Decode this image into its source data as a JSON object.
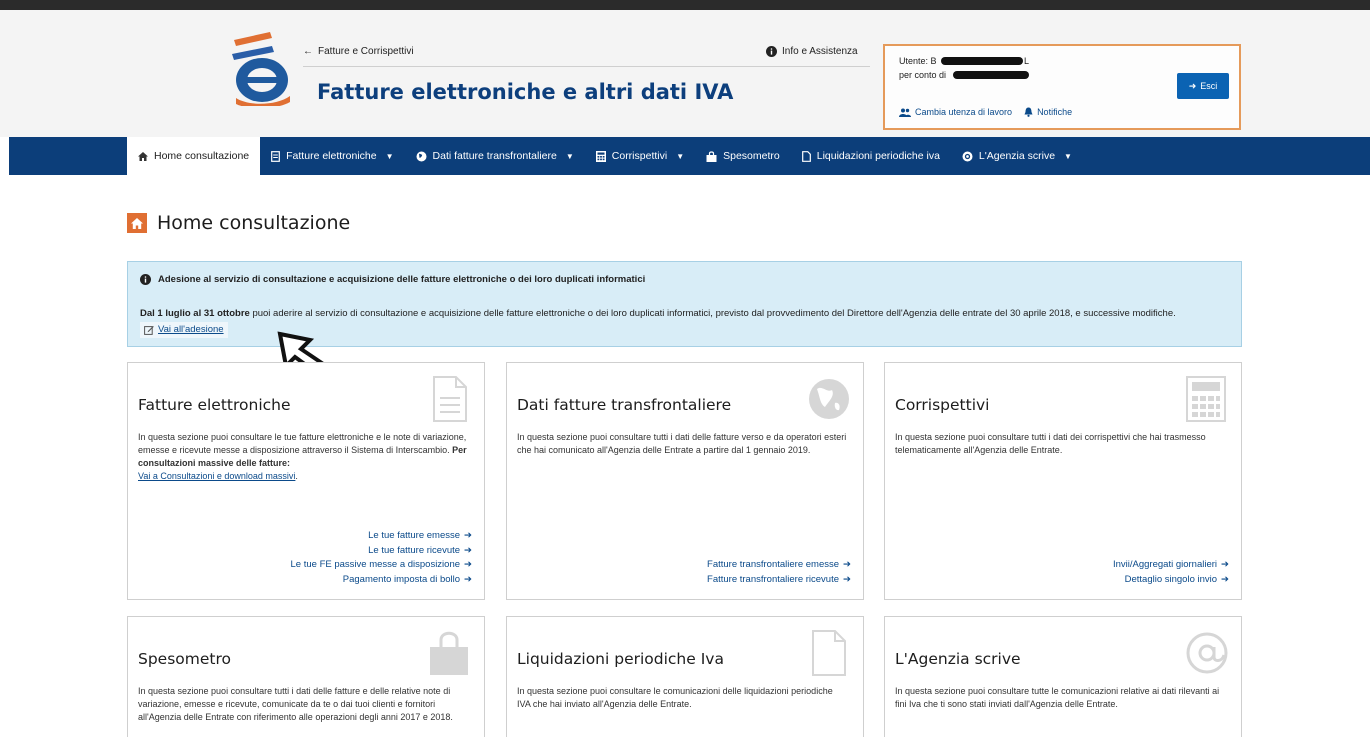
{
  "header": {
    "back_link": "Fatture e Corrispettivi",
    "info_link": "Info e Assistenza",
    "title": "Fatture elettroniche e altri dati IVA",
    "user": {
      "utente_label": "Utente: B",
      "utente_suffix": "L",
      "per_conto_label": "per conto di",
      "exit_label": "Esci",
      "cambia_utenza": "Cambia utenza di lavoro",
      "notifiche": "Notifiche"
    }
  },
  "nav": {
    "items": [
      {
        "label": "Home consultazione",
        "icon": "home-icon",
        "active": true,
        "dropdown": false
      },
      {
        "label": "Fatture elettroniche",
        "icon": "document-icon",
        "active": false,
        "dropdown": true
      },
      {
        "label": "Dati fatture transfrontaliere",
        "icon": "globe-icon",
        "active": false,
        "dropdown": true
      },
      {
        "label": "Corrispettivi",
        "icon": "calculator-icon",
        "active": false,
        "dropdown": true
      },
      {
        "label": "Spesometro",
        "icon": "bag-icon",
        "active": false,
        "dropdown": false
      },
      {
        "label": "Liquidazioni periodiche iva",
        "icon": "file-icon",
        "active": false,
        "dropdown": false
      },
      {
        "label": "L'Agenzia scrive",
        "icon": "at-icon",
        "active": false,
        "dropdown": true
      }
    ]
  },
  "page": {
    "title": "Home consultazione"
  },
  "alert": {
    "heading": "Adesione al servizio di consultazione e acquisizione delle fatture elettroniche o dei loro duplicati informatici",
    "bold_dates": "Dal 1 luglio al 31 ottobre",
    "body": " puoi aderire al servizio di consultazione e acquisizione delle fatture elettroniche o dei loro duplicati informatici, previsto dal provvedimento del Direttore dell'Agenzia delle entrate del 30 aprile 2018, e successive modifiche.",
    "link": "Vai all'adesione"
  },
  "cards": {
    "fatture": {
      "title": "Fatture elettroniche",
      "text": "In questa sezione puoi consultare le tue fatture elettroniche e le note di variazione, emesse e ricevute messe a disposizione attraverso il Sistema di Interscambio.",
      "bold": "Per consultazioni massive delle fatture:",
      "link": "Vai a Consultazioni e download massivi",
      "links": [
        "Le tue fatture emesse",
        "Le tue fatture ricevute",
        "Le tue FE passive messe a disposizione",
        "Pagamento imposta di bollo"
      ]
    },
    "transfrontaliere": {
      "title": "Dati fatture transfrontaliere",
      "text": "In questa sezione puoi consultare tutti i dati delle fatture verso e da operatori esteri che hai comunicato all'Agenzia delle Entrate a partire dal 1 gennaio 2019.",
      "links": [
        "Fatture transfrontaliere emesse",
        "Fatture transfrontaliere ricevute"
      ]
    },
    "corrispettivi": {
      "title": "Corrispettivi",
      "text": "In questa sezione puoi consultare tutti i dati dei corrispettivi che hai trasmesso telematicamente all'Agenzia delle Entrate.",
      "links": [
        "Invii/Aggregati giornalieri",
        "Dettaglio singolo invio"
      ]
    },
    "spesometro": {
      "title": "Spesometro",
      "text": "In questa sezione puoi consultare tutti i dati delle fatture e delle relative note di variazione, emesse e ricevute, comunicate da te o dai tuoi clienti e fornitori all'Agenzia delle Entrate con riferimento alle operazioni degli anni 2017 e 2018."
    },
    "liquidazioni": {
      "title": "Liquidazioni periodiche Iva",
      "text": "In questa sezione puoi consultare le comunicazioni delle liquidazioni periodiche IVA che hai inviato all'Agenzia delle Entrate."
    },
    "agenzia": {
      "title": "L'Agenzia scrive",
      "text": "In questa sezione puoi consultare tutte le comunicazioni relative ai dati rilevanti ai fini Iva che ti sono stati inviati dall'Agenzia delle Entrate."
    }
  },
  "colors": {
    "navbar": "#0c3e7a",
    "title_blue": "#0d3f7d",
    "accent_orange": "#e06f33",
    "alert_bg": "#d8edf7",
    "button_blue": "#0b63b3"
  }
}
